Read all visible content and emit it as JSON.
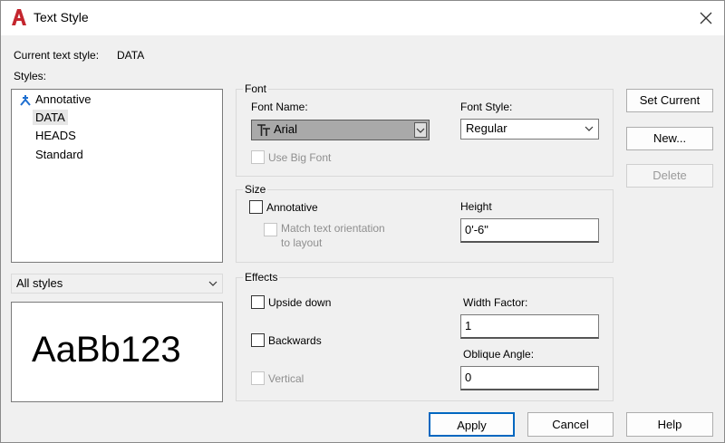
{
  "window": {
    "title": "Text Style"
  },
  "current_style": {
    "label": "Current text style:",
    "value": "DATA"
  },
  "styles": {
    "label": "Styles:",
    "items": [
      {
        "label": "Annotative",
        "icon": "annotative-icon"
      },
      {
        "label": "DATA",
        "selected": true
      },
      {
        "label": "HEADS"
      },
      {
        "label": "Standard"
      }
    ],
    "filter_value": "All styles"
  },
  "preview": {
    "text": "AaBb123"
  },
  "font": {
    "group_label": "Font",
    "font_name_label": "Font Name:",
    "font_name_value": "Arial",
    "font_style_label": "Font Style:",
    "font_style_value": "Regular",
    "big_font_label": "Use Big Font"
  },
  "size": {
    "group_label": "Size",
    "annotative_label": "Annotative",
    "match_label_line1": "Match text orientation",
    "match_label_line2": "to layout",
    "height_label": "Height",
    "height_value": "0'-6\""
  },
  "effects": {
    "group_label": "Effects",
    "upside_down_label": "Upside down",
    "backwards_label": "Backwards",
    "vertical_label": "Vertical",
    "width_factor_label": "Width Factor:",
    "width_factor_value": "1",
    "oblique_label": "Oblique Angle:",
    "oblique_value": "0"
  },
  "buttons": {
    "set_current": "Set Current",
    "new": "New...",
    "delete": "Delete",
    "apply": "Apply",
    "cancel": "Cancel",
    "help": "Help"
  },
  "colors": {
    "accent": "#c4262e",
    "annotative_blue": "#1f6fd0",
    "selected_bg": "#a9a9a9"
  }
}
